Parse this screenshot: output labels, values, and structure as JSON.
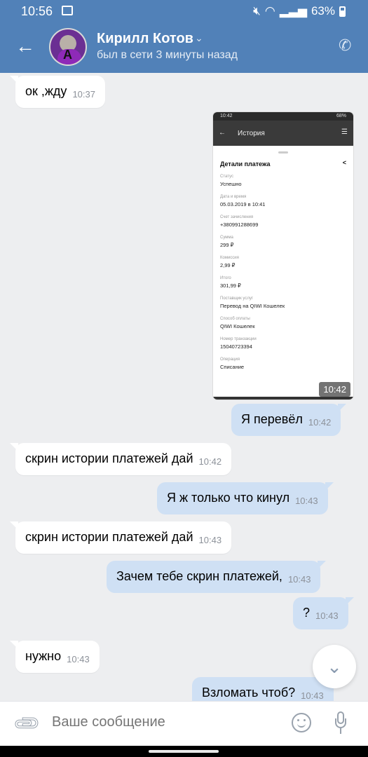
{
  "status_bar": {
    "time": "10:56",
    "battery": "63%"
  },
  "header": {
    "name": "Кирилл Котов",
    "subtitle": "был в сети 3 минуты назад"
  },
  "attachment": {
    "status_time": "10:42",
    "status_right": "68%",
    "screen_title": "История",
    "panel_title": "Детали платежа",
    "fields": [
      {
        "label": "Статус",
        "value": "Успешно"
      },
      {
        "label": "Дата и время",
        "value": "05.03.2019 в 10:41"
      },
      {
        "label": "Счет зачисления",
        "value": "+380991288699"
      },
      {
        "label": "Сумма",
        "value": "299 ₽"
      },
      {
        "label": "Комиссия",
        "value": "2,99 ₽"
      },
      {
        "label": "Итого",
        "value": "301,99 ₽"
      },
      {
        "label": "Поставщик услуг",
        "value": "Перевод на QIWI Кошелек"
      },
      {
        "label": "Способ оплаты",
        "value": "QIWI Кошелек"
      },
      {
        "label": "Номер транзакции",
        "value": "15040723394"
      },
      {
        "label": "Операция",
        "value": "Списание"
      }
    ],
    "time": "10:42"
  },
  "messages": [
    {
      "text": "ок ,жду",
      "time": "10:37"
    },
    {
      "text": "Я перевёл",
      "time": "10:42"
    },
    {
      "text": "скрин истории платежей дай",
      "time": "10:42"
    },
    {
      "text": "Я ж только что кинул",
      "time": "10:43"
    },
    {
      "text": "скрин истории платежей дай",
      "time": "10:43"
    },
    {
      "text": "Зачем тебе скрин платежей,",
      "time": "10:43"
    },
    {
      "text": "?",
      "time": "10:43"
    },
    {
      "text": "нужно",
      "time": "10:43"
    },
    {
      "text": "Взломать чтоб?",
      "time": "10:43"
    }
  ],
  "composer": {
    "placeholder": "Ваше сообщение"
  },
  "icons": [
    "image-icon",
    "mute-icon",
    "wifi-icon",
    "signal-icon",
    "battery-icon",
    "back-arrow-icon",
    "chevron-down-icon",
    "phone-icon",
    "attach-icon",
    "emoji-icon",
    "mic-icon",
    "scroll-down-icon"
  ]
}
